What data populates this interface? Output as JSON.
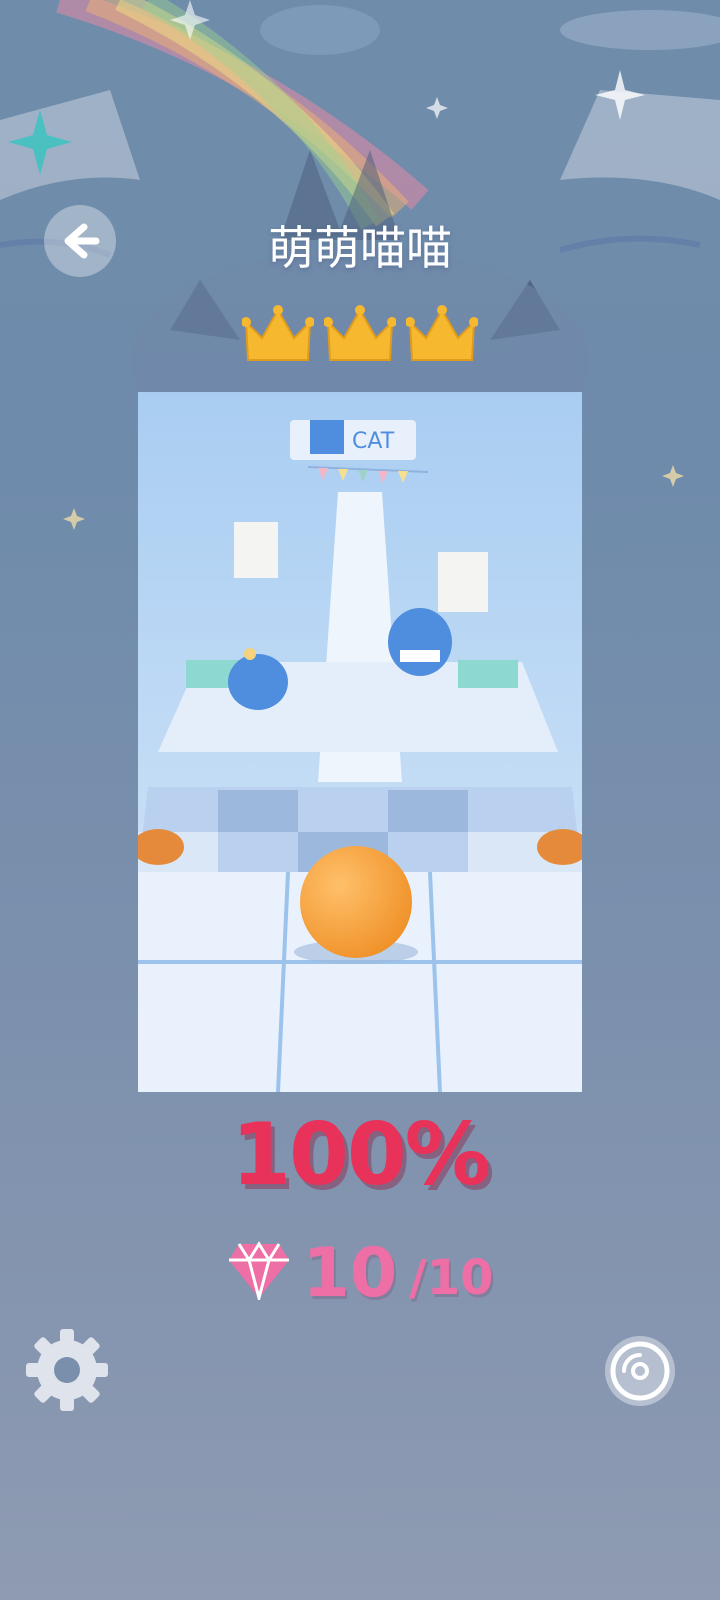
{
  "level": {
    "title": "萌萌喵喵",
    "crowns_earned": 3,
    "crowns_total": 3,
    "progress_label": "100%",
    "gems_collected": "10",
    "gems_total": "/10"
  },
  "preview": {
    "sign_text": "CAT"
  },
  "icons": {
    "back": "back-arrow-icon",
    "crown": "crown-icon",
    "gem": "diamond-icon",
    "settings": "gear-icon",
    "music": "vinyl-disc-icon"
  },
  "colors": {
    "background": "#6f8cab",
    "crown": "#f5b82e",
    "percent": "#e8325a",
    "gem": "#ee6fa6",
    "ball": "#f5a23a"
  }
}
